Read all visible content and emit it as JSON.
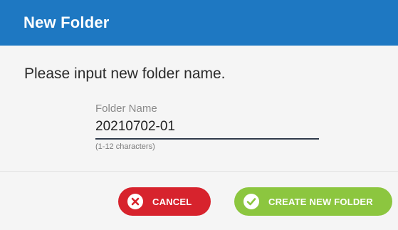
{
  "dialog": {
    "title": "New Folder",
    "prompt": "Please input new folder name.",
    "field": {
      "label": "Folder Name",
      "value": "20210702-01",
      "hint": "(1-12 characters)"
    },
    "buttons": {
      "cancel": {
        "label": "CANCEL",
        "icon": "close-icon",
        "color": "#d7232d"
      },
      "create": {
        "label": "CREATE NEW FOLDER",
        "icon": "check-icon",
        "color": "#8cc63f"
      }
    }
  },
  "colors": {
    "header": "#1e78c2",
    "background": "#f5f5f5"
  }
}
